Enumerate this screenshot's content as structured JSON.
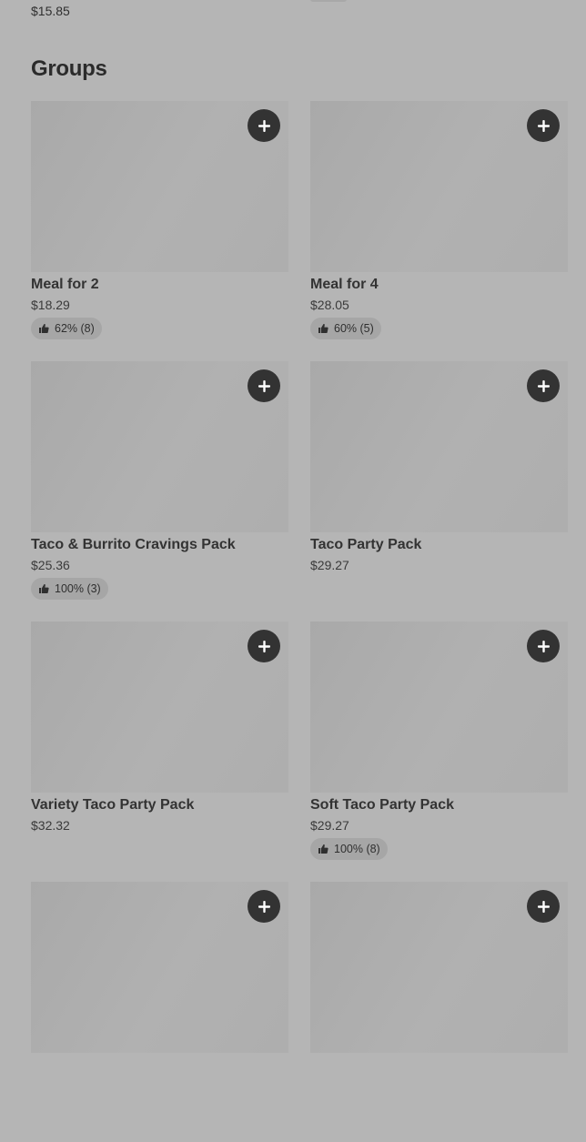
{
  "prev_item": {
    "price": "$15.85"
  },
  "section": {
    "title": "Groups"
  },
  "items": [
    {
      "name": "Meal for 2",
      "price": "$18.29",
      "rating": "62% (8)"
    },
    {
      "name": "Meal for 4",
      "price": "$28.05",
      "rating": "60% (5)"
    },
    {
      "name": "Taco & Burrito Cravings Pack",
      "price": "$25.36",
      "rating": "100% (3)"
    },
    {
      "name": "Taco Party Pack",
      "price": "$29.27",
      "rating": null
    },
    {
      "name": "Variety Taco Party Pack",
      "price": "$32.32",
      "rating": null
    },
    {
      "name": "Soft Taco Party Pack",
      "price": "$29.27",
      "rating": "100% (8)"
    },
    {
      "name": "",
      "price": "",
      "rating": null
    },
    {
      "name": "",
      "price": "",
      "rating": null
    }
  ],
  "icons": {
    "add": "plus-icon",
    "rating": "thumbs-up-icon"
  },
  "colors": {
    "background": "#b5b5b5",
    "add_button": "#333333",
    "rating_pill": "#a6a6a6"
  }
}
